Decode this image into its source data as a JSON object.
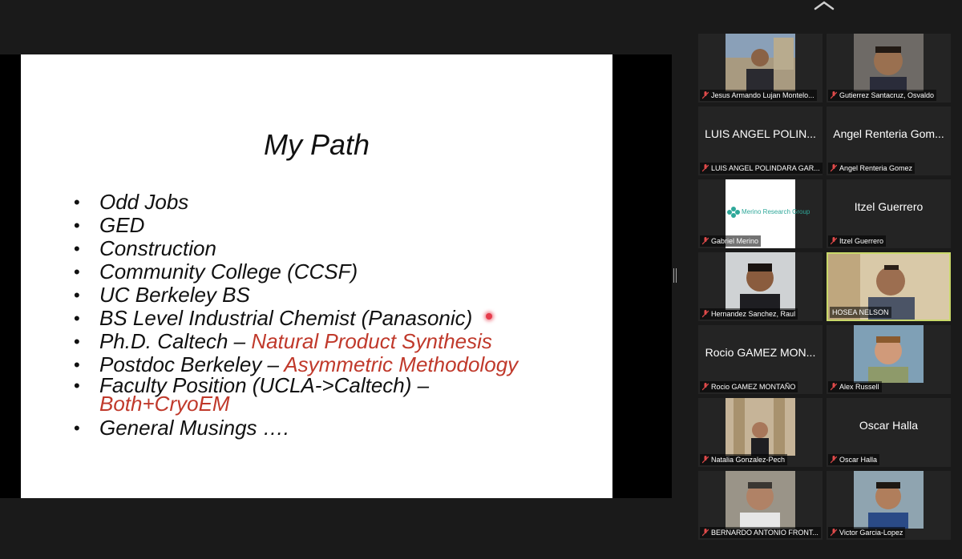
{
  "slide": {
    "title": "My Path",
    "bullets": [
      {
        "text": "Odd Jobs",
        "accent": ""
      },
      {
        "text": "GED",
        "accent": ""
      },
      {
        "text": "Construction",
        "accent": ""
      },
      {
        "text": "Community College (CCSF)",
        "accent": ""
      },
      {
        "text": "UC Berkeley BS",
        "accent": ""
      },
      {
        "text": "BS Level Industrial Chemist (Panasonic)",
        "accent": ""
      },
      {
        "text": "Ph.D. Caltech – ",
        "accent": "Natural Product Synthesis"
      },
      {
        "text": "Postdoc Berkeley – ",
        "accent": "Asymmetric Methodology"
      },
      {
        "text": "Faculty Position (UCLA->Caltech) – ",
        "accent": "Both+CryoEM"
      },
      {
        "text": "General Musings ….",
        "accent": ""
      }
    ],
    "accent_color": "#c0392b"
  },
  "participants": [
    {
      "label": "Jesus Armando Lujan Montelo...",
      "name": "",
      "muted": true
    },
    {
      "label": "Gutierrez Santacruz, Osvaldo",
      "name": "",
      "muted": true
    },
    {
      "label": "LUIS ANGEL POLINDARA GAR...",
      "name": "LUIS ANGEL POLIN...",
      "muted": true
    },
    {
      "label": "Angel Renteria Gomez",
      "name": "Angel Renteria Gom...",
      "muted": true
    },
    {
      "label": "Gabriel Merino",
      "name": "",
      "muted": true,
      "logo_text": "Merino Research Group"
    },
    {
      "label": "Itzel Guerrero",
      "name": "Itzel Guerrero",
      "muted": true
    },
    {
      "label": "Hernandez Sanchez, Raul",
      "name": "",
      "muted": true
    },
    {
      "label": "HOSEA NELSON",
      "name": "",
      "muted": false,
      "active": true
    },
    {
      "label": "Rocio GAMEZ MONTAÑO",
      "name": "Rocio GAMEZ MON...",
      "muted": true
    },
    {
      "label": "Alex Russell",
      "name": "",
      "muted": true
    },
    {
      "label": "Natalia Gonzalez-Pech",
      "name": "",
      "muted": true
    },
    {
      "label": "Oscar Halla",
      "name": "Oscar Halla",
      "muted": true
    },
    {
      "label": "BERNARDO ANTONIO FRONT...",
      "name": "",
      "muted": true
    },
    {
      "label": "Victor Garcia-Lopez",
      "name": "",
      "muted": true
    }
  ]
}
